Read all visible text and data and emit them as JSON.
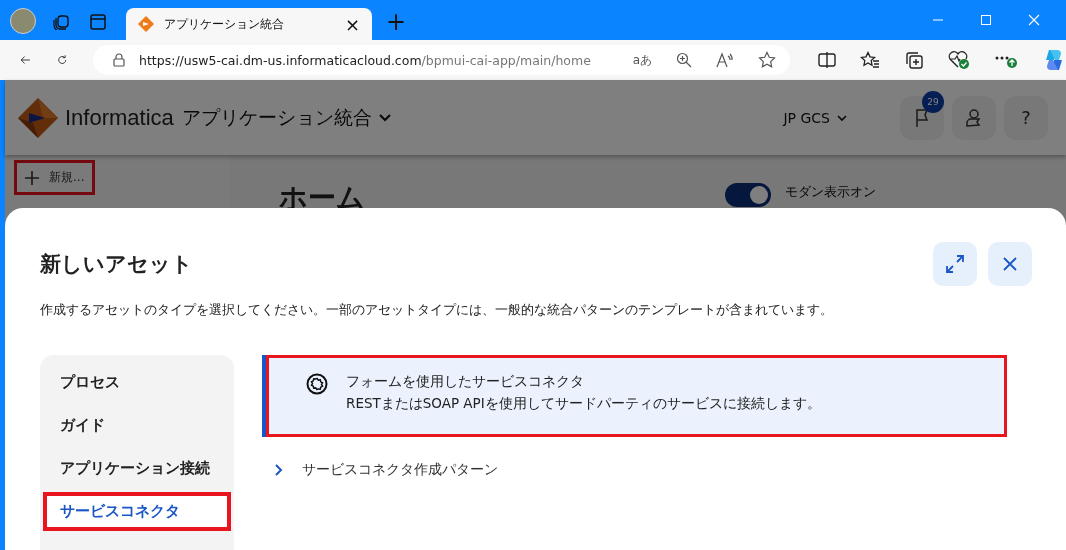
{
  "browser": {
    "tabs": [
      {
        "title": "アプリケーション統合",
        "close": "×",
        "selected": true
      }
    ],
    "new_tab": "+",
    "url_host": "https://usw5-cai.dm-us.informaticacloud.com",
    "url_path": "/bpmui-cai-app/main/home",
    "read_aloud": "aあ"
  },
  "app": {
    "brand": "Informatica",
    "product": "アプリケーション統合",
    "org": "JP GCS",
    "notification_count": "29",
    "help": "?",
    "new_button": {
      "label": "新規...",
      "highlighted": true
    },
    "page_title": "ホーム",
    "modern_view": {
      "label": "モダン表示オン",
      "on": true
    }
  },
  "dialog": {
    "title": "新しいアセット",
    "description": "作成するアセットのタイプを選択してください。一部のアセットタイプには、一般的な統合パターンのテンプレートが含まれています。",
    "categories": [
      {
        "label": "プロセス",
        "selected": false,
        "highlighted": false
      },
      {
        "label": "ガイド",
        "selected": false,
        "highlighted": false
      },
      {
        "label": "アプリケーション接続",
        "selected": false,
        "highlighted": false
      },
      {
        "label": "サービスコネクタ",
        "selected": true,
        "highlighted": true
      }
    ],
    "options": [
      {
        "title": "フォームを使用したサービスコネクタ",
        "description": "RESTまたはSOAP APIを使用してサードパーティのサービスに接続します。",
        "selected": true,
        "highlighted": true
      }
    ],
    "groups": [
      {
        "label": "サービスコネクタ作成パターン",
        "expanded": false
      }
    ]
  }
}
